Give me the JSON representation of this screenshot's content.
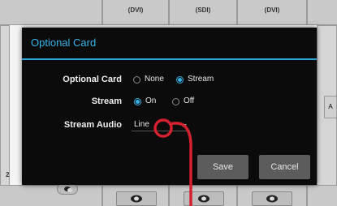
{
  "background": {
    "columns": [
      "(DVI)",
      "(SDI)",
      "(DVI)"
    ],
    "side_numbers": [
      "2"
    ],
    "right_tab": "A"
  },
  "dialog": {
    "title": "Optional Card",
    "rows": [
      {
        "label": "Optional Card",
        "options": [
          "None",
          "Stream"
        ],
        "selected": "Stream"
      },
      {
        "label": "Stream",
        "options": [
          "On",
          "Off"
        ],
        "selected": "On"
      },
      {
        "label": "Stream Audio",
        "value": "Line"
      }
    ],
    "save_label": "Save",
    "cancel_label": "Cancel"
  },
  "colors": {
    "accent": "#35b4e8",
    "dialog_bg": "#0b0b0b",
    "button_bg": "#5c5c5c",
    "pointer": "#d5202f"
  },
  "annotation": {
    "icon": "red-pointer-circle-icon"
  }
}
